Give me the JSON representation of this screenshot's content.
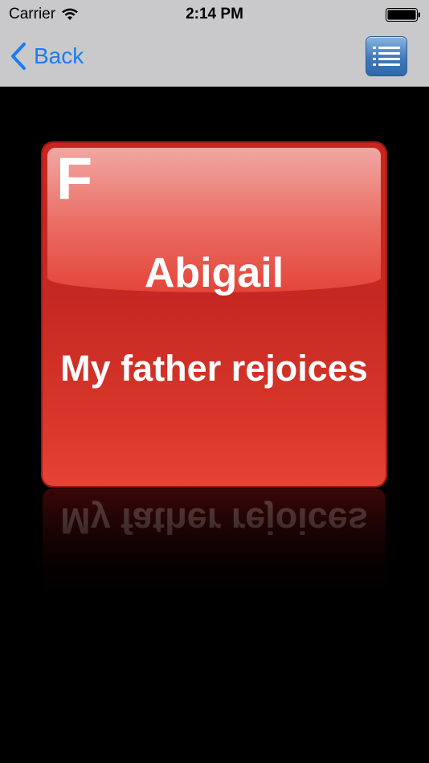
{
  "status_bar": {
    "carrier": "Carrier",
    "time": "2:14 PM",
    "icons": [
      "wifi-icon",
      "battery-icon"
    ]
  },
  "nav_bar": {
    "back_label": "Back",
    "back_icon": "chevron-left-icon",
    "menu_icon": "list-icon"
  },
  "card": {
    "letter": "F",
    "name": "Abigail",
    "meaning": "My father rejoices",
    "colors": {
      "card_red": "#c9251f",
      "gloss_top": "#f1a7a3",
      "text": "#ffffff"
    }
  },
  "colors": {
    "nav_background": "#c9c9cb",
    "accent_blue": "#1a7cf5",
    "background": "#000000"
  }
}
